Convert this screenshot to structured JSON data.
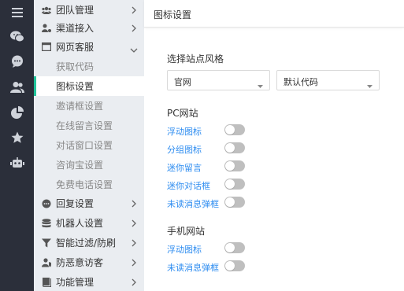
{
  "rail": {
    "icons": [
      "menu-icon",
      "wechat-icon",
      "chat-icon",
      "users-icon",
      "pie-chart-icon",
      "star-icon",
      "robot-icon"
    ]
  },
  "nav": {
    "groups_top": [
      {
        "label": "团队管理",
        "icon": "team-icon"
      },
      {
        "label": "渠道接入",
        "icon": "channel-icon"
      },
      {
        "label": "网页客服",
        "icon": "web-icon"
      }
    ],
    "subitems": [
      {
        "label": "获取代码"
      },
      {
        "label": "图标设置",
        "active": true
      },
      {
        "label": "邀请框设置"
      },
      {
        "label": "在线留言设置"
      },
      {
        "label": "对话窗口设置"
      },
      {
        "label": "咨询宝设置"
      },
      {
        "label": "免费电话设置"
      }
    ],
    "groups_bottom": [
      {
        "label": "回复设置",
        "icon": "reply-icon"
      },
      {
        "label": "机器人设置",
        "icon": "database-icon"
      },
      {
        "label": "智能过滤/防刷",
        "icon": "filter-icon"
      },
      {
        "label": "防恶意访客",
        "icon": "shield-user-icon"
      },
      {
        "label": "功能管理",
        "icon": "function-icon"
      }
    ]
  },
  "main": {
    "title": "图标设置",
    "site_style_label": "选择站点风格",
    "select_site": {
      "value": "官网"
    },
    "select_code": {
      "value": "默认代码"
    },
    "pc_title": "PC网站",
    "pc_options": [
      {
        "label": "浮动图标",
        "enabled": false
      },
      {
        "label": "分组图标",
        "enabled": false
      },
      {
        "label": "迷你留言",
        "enabled": false
      },
      {
        "label": "迷你对话框",
        "enabled": false
      },
      {
        "label": "未读消息弹框",
        "enabled": false
      }
    ],
    "mobile_title": "手机网站",
    "mobile_options": [
      {
        "label": "浮动图标",
        "enabled": false
      },
      {
        "label": "未读消息弹框",
        "enabled": false
      }
    ]
  },
  "colors": {
    "rail_bg": "#2b2f3a",
    "nav_bg": "#eaedf1",
    "active_accent": "#21c39a",
    "link": "#2d8cf0",
    "toggle_off": "#bfbfbf"
  }
}
